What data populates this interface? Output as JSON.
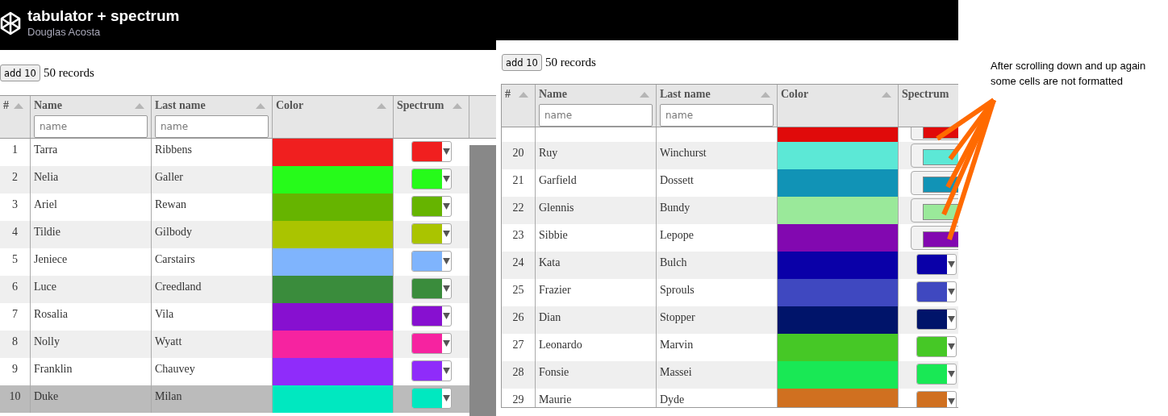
{
  "header": {
    "title": "tabulator + spectrum",
    "author": "Douglas Acosta"
  },
  "panels": [
    {
      "button": "add 10",
      "record_count": "50 records",
      "table": {
        "columns": [
          {
            "title": "#"
          },
          {
            "title": "Name",
            "filter_placeholder": "name"
          },
          {
            "title": "Last name",
            "filter_placeholder": "name"
          },
          {
            "title": "Color"
          },
          {
            "title": "Spectrum"
          }
        ],
        "rows": [
          {
            "number": "1",
            "name": "Tarra",
            "last_name": "Ribbens",
            "color": "#f01f1f",
            "kind": "formatted",
            "selected": false
          },
          {
            "number": "2",
            "name": "Nelia",
            "last_name": "Galler",
            "color": "#26fb1a",
            "kind": "formatted",
            "selected": false
          },
          {
            "number": "3",
            "name": "Ariel",
            "last_name": "Rewan",
            "color": "#66b400",
            "kind": "formatted",
            "selected": false
          },
          {
            "number": "4",
            "name": "Tildie",
            "last_name": "Gilbody",
            "color": "#aac400",
            "kind": "formatted",
            "selected": false
          },
          {
            "number": "5",
            "name": "Jeniece",
            "last_name": "Carstairs",
            "color": "#7fb4fd",
            "kind": "formatted",
            "selected": false
          },
          {
            "number": "6",
            "name": "Luce",
            "last_name": "Creedland",
            "color": "#3a8c3c",
            "kind": "formatted",
            "selected": false
          },
          {
            "number": "7",
            "name": "Rosalia",
            "last_name": "Vila",
            "color": "#8710d0",
            "kind": "formatted",
            "selected": false
          },
          {
            "number": "8",
            "name": "Nolly",
            "last_name": "Wyatt",
            "color": "#f623a0",
            "kind": "formatted",
            "selected": false
          },
          {
            "number": "9",
            "name": "Franklin",
            "last_name": "Chauvey",
            "color": "#8f2cfa",
            "kind": "formatted",
            "selected": false
          },
          {
            "number": "10",
            "name": "Duke",
            "last_name": "Milan",
            "color": "#00e8c0",
            "kind": "formatted",
            "selected": true
          }
        ]
      }
    },
    {
      "button": "add 10",
      "record_count": "50 records",
      "table": {
        "columns": [
          {
            "title": "#"
          },
          {
            "title": "Name",
            "filter_placeholder": "name"
          },
          {
            "title": "Last name",
            "filter_placeholder": "name"
          },
          {
            "title": "Color"
          },
          {
            "title": "Spectrum"
          }
        ],
        "rows": [
          {
            "color": "#e00a0a",
            "kind": "plain",
            "selected": false
          },
          {
            "number": "20",
            "name": "Ruy",
            "last_name": "Winchurst",
            "color": "#5ce8d6",
            "kind": "plain",
            "selected": false
          },
          {
            "number": "21",
            "name": "Garfield",
            "last_name": "Dossett",
            "color": "#1193b6",
            "kind": "plain",
            "selected": false
          },
          {
            "number": "22",
            "name": "Glennis",
            "last_name": "Bundy",
            "color": "#9ae99a",
            "kind": "plain",
            "selected": false
          },
          {
            "number": "23",
            "name": "Sibbie",
            "last_name": "Lepope",
            "color": "#8208b0",
            "kind": "plain",
            "selected": false
          },
          {
            "number": "24",
            "name": "Kata",
            "last_name": "Bulch",
            "color": "#0a00a8",
            "kind": "formatted",
            "selected": false
          },
          {
            "number": "25",
            "name": "Frazier",
            "last_name": "Sprouls",
            "color": "#3f48c0",
            "kind": "formatted",
            "selected": false
          },
          {
            "number": "26",
            "name": "Dian",
            "last_name": "Stopper",
            "color": "#00146a",
            "kind": "formatted",
            "selected": false
          },
          {
            "number": "27",
            "name": "Leonardo",
            "last_name": "Marvin",
            "color": "#46c826",
            "kind": "formatted",
            "selected": false
          },
          {
            "number": "28",
            "name": "Fonsie",
            "last_name": "Massei",
            "color": "#19e855",
            "kind": "formatted",
            "selected": false
          },
          {
            "number": "29",
            "name": "Maurie",
            "last_name": "Dyde",
            "color": "#d07020",
            "kind": "formatted",
            "selected": false
          }
        ]
      }
    }
  ],
  "annotation": {
    "text": "After scrolling down and up again\nsome cells are not formatted"
  }
}
